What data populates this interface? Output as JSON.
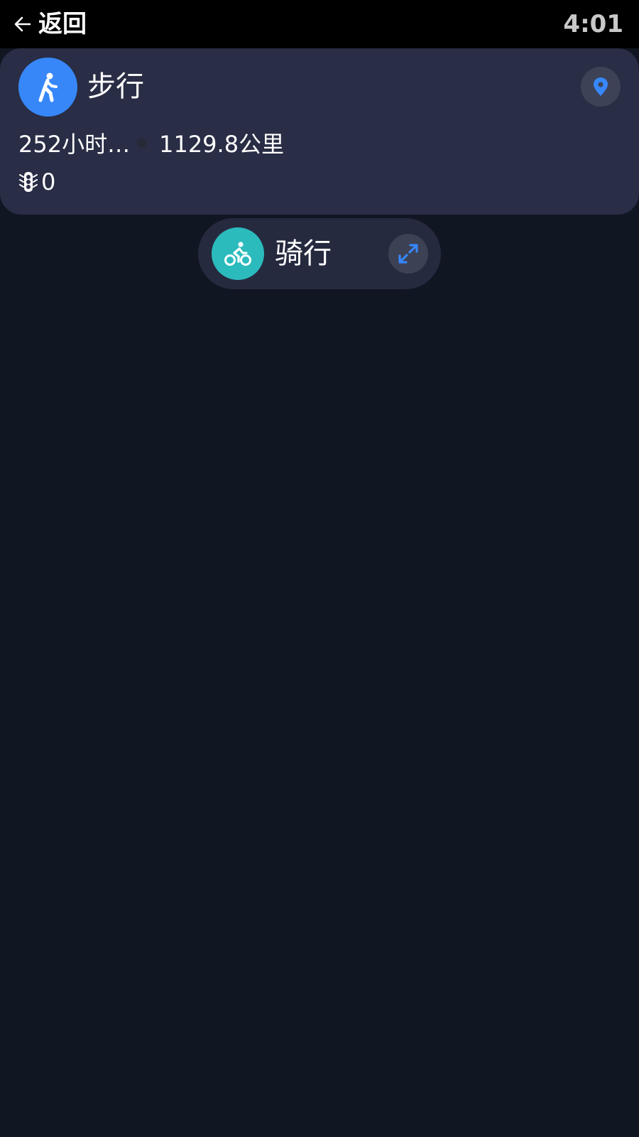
{
  "status_bar": {
    "back_label": "返回",
    "time": "4:01"
  },
  "walk_card": {
    "mode_label": "步行",
    "duration": "252小时…",
    "distance": "1129.8公里",
    "traffic_lights": "0",
    "mode_icon": "walking-person-icon",
    "location_icon": "location-pin-icon"
  },
  "ride_card": {
    "mode_label": "骑行",
    "mode_icon": "cyclist-icon",
    "expand_icon": "expand-icon"
  },
  "colors": {
    "background": "#111623",
    "card": "#292d45",
    "walk_accent": "#3787f9",
    "ride_accent": "#2cbbbd"
  }
}
